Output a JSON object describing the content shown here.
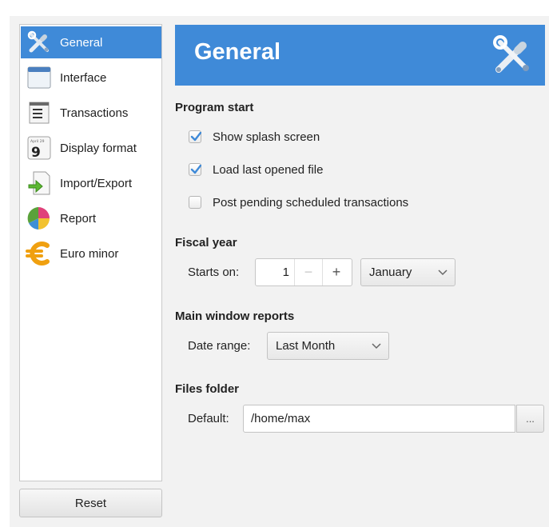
{
  "sidebar": {
    "items": [
      {
        "label": "General",
        "icon": "tools-icon",
        "active": true
      },
      {
        "label": "Interface",
        "icon": "window-icon"
      },
      {
        "label": "Transactions",
        "icon": "document-lines-icon"
      },
      {
        "label": "Display format",
        "icon": "calendar-icon"
      },
      {
        "label": "Import/Export",
        "icon": "import-export-icon"
      },
      {
        "label": "Report",
        "icon": "pie-chart-icon"
      },
      {
        "label": "Euro minor",
        "icon": "euro-icon"
      }
    ],
    "calendar_month": "April 29",
    "calendar_day": "9",
    "reset_label": "Reset"
  },
  "header": {
    "title": "General",
    "icon": "tools-icon",
    "color": "#3f8ad8"
  },
  "program_start": {
    "title": "Program start",
    "options": [
      {
        "label": "Show splash screen",
        "checked": true
      },
      {
        "label": "Load last opened file",
        "checked": true
      },
      {
        "label": "Post pending scheduled transactions",
        "checked": false
      }
    ]
  },
  "fiscal_year": {
    "title": "Fiscal year",
    "starts_label": "Starts on:",
    "day_value": "1",
    "minus": "−",
    "plus": "+",
    "month_value": "January"
  },
  "main_window_reports": {
    "title": "Main window reports",
    "date_range_label": "Date range:",
    "date_range_value": "Last Month"
  },
  "files_folder": {
    "title": "Files folder",
    "default_label": "Default:",
    "path_value": "/home/max",
    "browse_label": "..."
  },
  "colors": {
    "accent": "#3f8ad8",
    "check": "#3f8ad8"
  }
}
